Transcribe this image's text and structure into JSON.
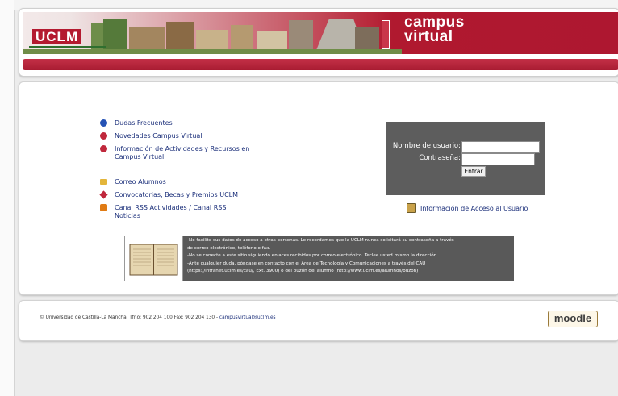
{
  "header": {
    "uclm_logo_text": "UCLM",
    "campus_logo_line1": "campus",
    "campus_logo_line2": "virtual"
  },
  "links_group1": [
    {
      "label": "Dudas Frecuentes",
      "icon": "help-icon",
      "color": "#2553b5"
    },
    {
      "label": "Novedades Campus Virtual",
      "icon": "news-icon",
      "color": "#c0283c"
    },
    {
      "label": "Información de Actividades y Recursos en Campus Virtual",
      "icon": "info-icon",
      "color": "#c0283c"
    }
  ],
  "links_group2": [
    {
      "label": "Correo Alumnos",
      "icon": "mail-icon",
      "color": "#e3b53a"
    },
    {
      "label": "Convocatorias, Becas y Premios UCLM",
      "icon": "award-icon",
      "color": "#c0283c"
    },
    {
      "label": "Canal RSS Actividades / Canal RSS Noticias",
      "icon": "rss-icon",
      "color": "#e07b14"
    }
  ],
  "login": {
    "username_label": "Nombre de usuario:",
    "password_label": "Contraseña:",
    "username_value": "",
    "password_value": "",
    "submit_label": "Entrar"
  },
  "access_info_link": "Información de Acceso al Usuario",
  "notice_lines": [
    "-No facilite sus datos de acceso a otras personas. Le recordamos que la UCLM nunca solicitará su contraseña a través",
    "de correo electrónico, teléfono o fax.",
    "-No se conecte a este sitio siguiendo enlaces recibidos por correo electrónico. Teclee usted mismo la dirección.",
    "-Ante cualquier duda, póngase en contacto con el Área de Tecnología y Comunicaciones a través del CAU",
    "(https://intranet.uclm.es/cau/, Ext. 3900) o del buzón del alumno (http://www.uclm.es/alumnos/buzon)"
  ],
  "footer": {
    "text": "© Universidad de Castilla-La Mancha. Tfno: 902 204 100 Fax: 902 204 130 - ",
    "email": "campusvirtual@uclm.es",
    "moodle_logo": "moodle"
  }
}
